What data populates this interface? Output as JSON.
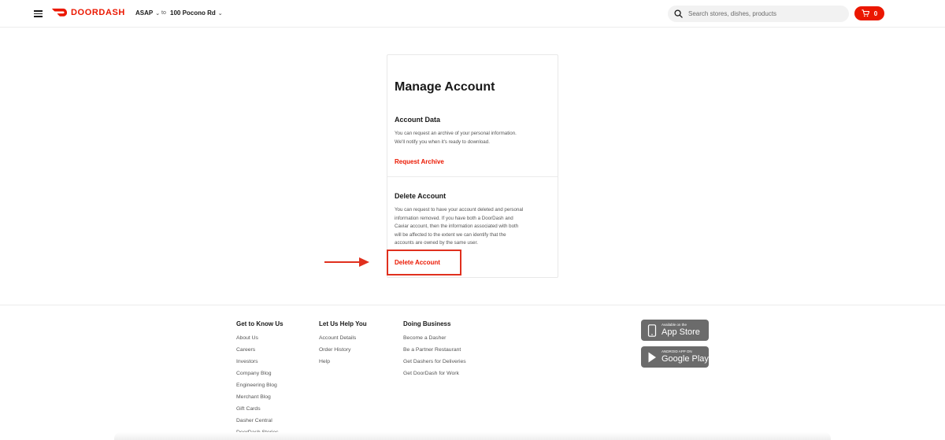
{
  "header": {
    "logo_text": "DOORDASH",
    "time_label": "ASAP",
    "to_label": "to",
    "address": "100 Pocono Rd",
    "search_placeholder": "Search stores, dishes, products",
    "cart_count": "0"
  },
  "manage": {
    "title": "Manage Account",
    "account_data": {
      "title": "Account Data",
      "description_lines": [
        "You can request an archive of your personal information.",
        "We'll notify you when it's ready to download."
      ],
      "link": "Request Archive"
    },
    "delete_account": {
      "title": "Delete Account",
      "description_lines": [
        "You can request to have your account deleted and personal",
        "information removed. If you have both a DoorDash and",
        "Caviar account, then the information associated with both",
        "will be affected to the extent we can identify that the",
        "accounts are owned by the same user."
      ],
      "link": "Delete Account"
    }
  },
  "footer": {
    "columns": [
      {
        "heading": "Get to Know Us",
        "links": [
          "About Us",
          "Careers",
          "Investors",
          "Company Blog",
          "Engineering Blog",
          "Merchant Blog",
          "Gift Cards",
          "Dasher Central",
          "DoorDash Stories"
        ]
      },
      {
        "heading": "Let Us Help You",
        "links": [
          "Account Details",
          "Order History",
          "Help"
        ]
      },
      {
        "heading": "Doing Business",
        "links": [
          "Become a Dasher",
          "Be a Partner Restaurant",
          "Get Dashers for Deliveries",
          "Get DoorDash for Work"
        ]
      }
    ],
    "app_store": {
      "small": "Available on the",
      "big": "App Store"
    },
    "google_play": {
      "small": "ANDROID APP ON",
      "big": "Google Play"
    }
  },
  "colors": {
    "brand": "#eb1700",
    "annotation": "#e0301e",
    "badge": "#6b6b6b"
  },
  "icons": [
    "hamburger-icon",
    "doordash-logo-icon",
    "search-icon",
    "cart-icon",
    "apple-icon",
    "google-play-icon",
    "annotation-arrow-icon"
  ]
}
